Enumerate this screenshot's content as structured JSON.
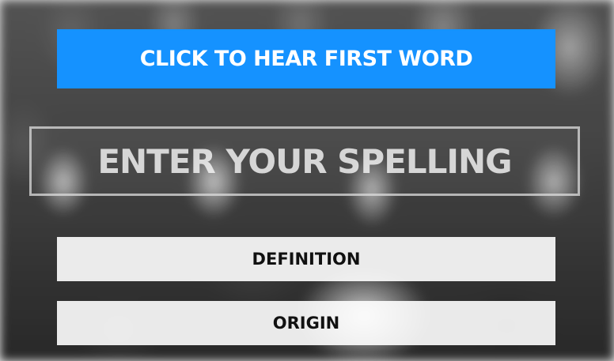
{
  "background": {
    "description_icon": "blurred-crowd-photo"
  },
  "colors": {
    "primary_button": "#1592ff",
    "secondary_button": "#ffffff",
    "primary_text": "#ffffff",
    "secondary_text": "#111111"
  },
  "hear_button": {
    "label": "CLICK TO HEAR FIRST WORD"
  },
  "spelling_input": {
    "value": "",
    "placeholder": "ENTER YOUR SPELLING"
  },
  "definition_button": {
    "label": "DEFINITION"
  },
  "origin_button": {
    "label": "ORIGIN"
  }
}
